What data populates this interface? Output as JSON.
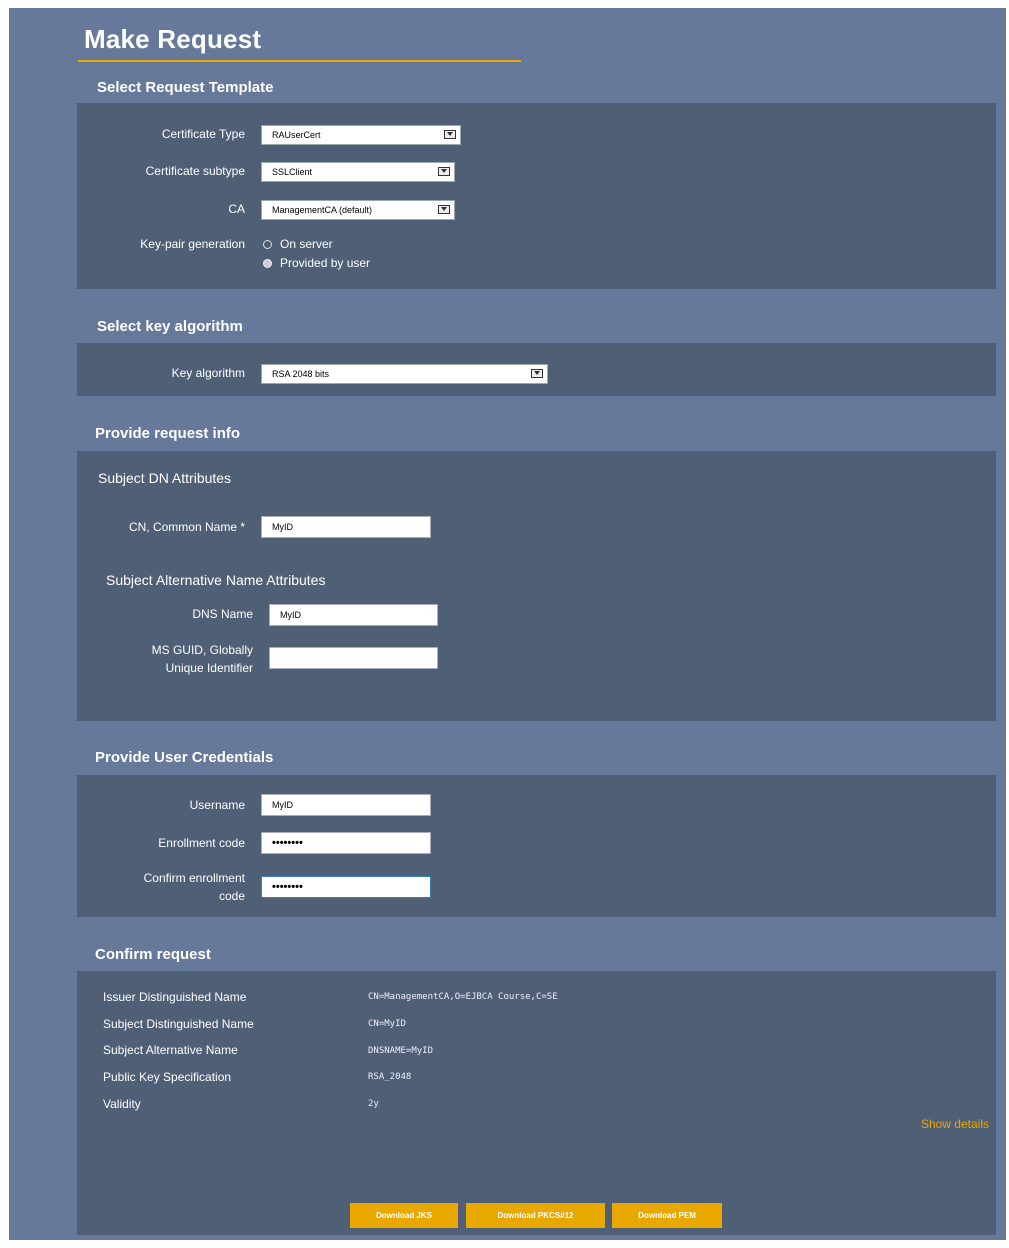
{
  "page": {
    "title": "Make Request",
    "accent_color": "#e8a800",
    "background_color": "#66799a",
    "panel_color": "#4e5f76"
  },
  "template": {
    "heading": "Select Request Template",
    "cert_type_label": "Certificate Type",
    "cert_type_value": "RAUserCert",
    "cert_subtype_label": "Certificate subtype",
    "cert_subtype_value": "SSLClient",
    "ca_label": "CA",
    "ca_value": "ManagementCA (default)",
    "keygen_label": "Key-pair generation",
    "keygen_option_server": "On server",
    "keygen_option_user": "Provided by user",
    "keygen_selected": "Provided by user"
  },
  "key_algorithm": {
    "heading": "Select key algorithm",
    "label": "Key algorithm",
    "value": "RSA 2048 bits"
  },
  "request_info": {
    "heading": "Provide request info",
    "subject_dn_heading": "Subject DN Attributes",
    "cn_label": "CN, Common Name *",
    "cn_value": "MyID",
    "san_heading": "Subject Alternative Name Attributes",
    "dns_label": "DNS Name",
    "dns_value": "MyID",
    "guid_label_line1": "MS GUID, Globally",
    "guid_label_line2": "Unique Identifier",
    "guid_value": ""
  },
  "credentials": {
    "heading": "Provide User Credentials",
    "username_label": "Username",
    "username_value": "MyID",
    "enroll_label": "Enrollment code",
    "enroll_value": "••••••••",
    "confirm_label_line1": "Confirm enrollment",
    "confirm_label_line2": "code",
    "confirm_value": "••••••••"
  },
  "confirm": {
    "heading": "Confirm request",
    "rows": [
      {
        "label": "Issuer Distinguished Name",
        "value": "CN=ManagementCA,O=EJBCA Course,C=SE"
      },
      {
        "label": "Subject Distinguished Name",
        "value": "CN=MyID"
      },
      {
        "label": "Subject Alternative Name",
        "value": "DNSNAME=MyID"
      },
      {
        "label": "Public Key Specification",
        "value": "RSA_2048"
      },
      {
        "label": "Validity",
        "value": "2y"
      }
    ],
    "show_details": "Show details",
    "buttons": {
      "jks": "Download JKS",
      "pkcs12": "Download PKCS#12",
      "pem": "Download PEM"
    }
  }
}
